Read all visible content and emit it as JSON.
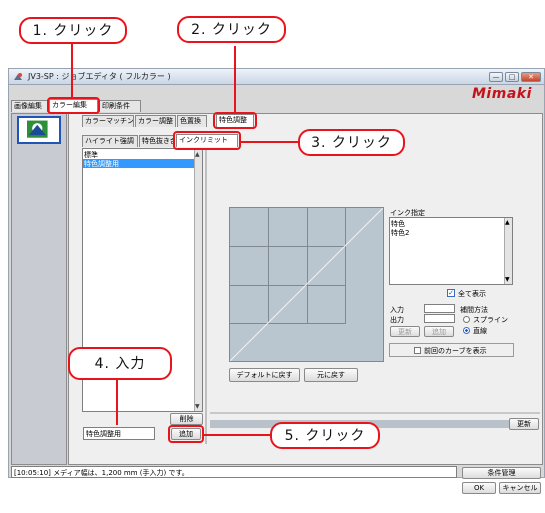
{
  "window": {
    "title": "JV3-SP : ジョブエディタ ( フルカラー )",
    "logo": "Mimaki",
    "min_glyph": "—",
    "max_glyph": "□",
    "close_glyph": "✕"
  },
  "top_tabs": [
    "画像編集",
    "カラー編集",
    "印刷条件"
  ],
  "sub_tabs": [
    "カラーマッチング",
    "カラー調整",
    "色置換",
    "特色調整"
  ],
  "inner_tabs": [
    "ハイライト強調",
    "特色抜き合",
    "インクリミット"
  ],
  "preset_list": {
    "items": [
      "標準",
      "特色調整用"
    ],
    "selected_index": 1
  },
  "name_input_value": "特色調整用",
  "delete_button": "削除",
  "add_button": "追加",
  "ink_spec": {
    "header": "インク指定",
    "items": [
      "特色",
      "特色2"
    ],
    "show_all_label": "全て表示",
    "show_all_checked": true
  },
  "io": {
    "input_label": "入力",
    "output_label": "出力",
    "update_button": "更新",
    "add_button": "追加"
  },
  "interp": {
    "label": "補間方法",
    "options": [
      "スプライン",
      "直線"
    ],
    "selected": "直線"
  },
  "show_prev_curve_label": "前回のカーブを表示",
  "default_button": "デフォルトに戻す",
  "revert_button": "元に戻す",
  "update_main_button": "更新",
  "status_message": "[10:05:10] メディア幅は、1,200 mm (手入力) です。",
  "condition_button": "条件管理",
  "ok_button": "OK",
  "cancel_button": "キャンセル",
  "callouts": {
    "c1": "1. クリック",
    "c2": "2. クリック",
    "c3": "3. クリック",
    "c4": "4. 入力",
    "c5": "5. クリック"
  },
  "colors": {
    "accent": "#e8141c",
    "selection": "#3399ff",
    "graph_bg": "#b9c5cf",
    "logo": "#c4131a"
  }
}
